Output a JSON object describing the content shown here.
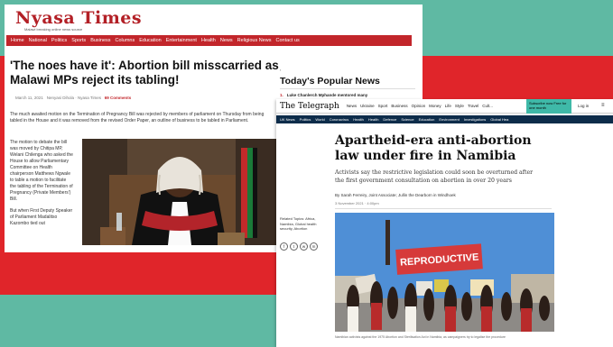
{
  "colors": {
    "background": "#5fb9a3",
    "red_band": "#e0252a",
    "nyasa_red": "#c2262b",
    "telegraph_navy": "#0d2c4a",
    "telegraph_teal": "#3fb9a8"
  },
  "nyasa": {
    "logo": "Nyasa Times",
    "tagline": "Malawi breaking online news source",
    "nav": [
      "Home",
      "National",
      "Politics",
      "Sports",
      "Business",
      "Columns",
      "Education",
      "Entertainment",
      "Health",
      "News",
      "Religious News",
      "Contact us"
    ],
    "headline": "'The noes have it': Abortion bill misscarried as Malawi MPs reject its tabling!",
    "meta_date": "March 11, 2021",
    "meta_author": "Nenyasi Dihola · Nyasa Times",
    "meta_comments": "69 Comments",
    "intro": "The much awaited motion on the Termination of Pregnancy Bill was rejected by members of parliament on Thursday from being tabled in the House and it was removed from the revised Order Paper, an outline of business to be tabled in Parliament.",
    "body_1": "The motion to debate the bill was moved by Chitipa MP, Welani Chilenga who asked the House to allow Parliamentary Committee on Health chairperson Matthews Ngwale to table a motion to facilitate the tabling of the Termination of Pregnancy (Private Members') Bill.",
    "body_2": "But when First Deputy Speaker of Parliament Madalitso Kazombo tied out",
    "popular_title": "Today's Popular News",
    "popular_item": "Luke Chanlerch Mphande mentored many",
    "popular_num": "1."
  },
  "telegraph": {
    "logo": "The Telegraph",
    "nav": [
      "News",
      "Ukraine",
      "Sport",
      "Business",
      "Opinion",
      "Money",
      "Life",
      "Style",
      "Travel",
      "Cult..."
    ],
    "subscribe": "Subscribe now Free for one month",
    "login": "Log in",
    "menu_icon": "≡",
    "subnav": [
      "UK News",
      "Politics",
      "World",
      "Coronavirus",
      "Health",
      "Health",
      "Defence",
      "Science",
      "Education",
      "Environment",
      "Investigations",
      "Global Hea"
    ],
    "headline": "Apartheid-era anti-abortion law under fire in Namibia",
    "standfirst": "Activists say the restrictive legislation could soon be overturned after the first government consultation on abortion in over 20 years",
    "byline": "By Sarah Ferreiry, Joint Associate; Jullin the Dearborn in Windhoek",
    "date": "3 November 2021 · 4:00pm",
    "related": "Related Topics: Africa, Namibia, Global health security, Abortion",
    "share_icons": [
      "f",
      "t",
      "w",
      "m"
    ],
    "photo_sign": "REPRODUCTIVE",
    "caption": "Namibian activists against the 1975 Abortion and Sterilisation Act in Namibia, as campaigners try to legalise the procedure"
  }
}
